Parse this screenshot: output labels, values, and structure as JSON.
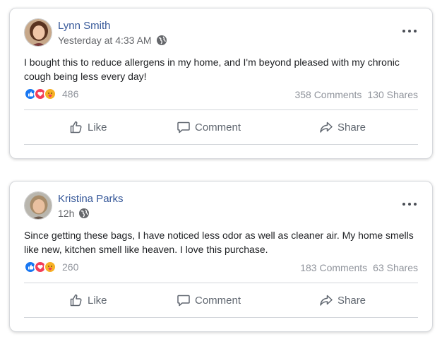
{
  "posts": [
    {
      "author": "Lynn Smith",
      "time": "Yesterday at 4:33 AM",
      "text": "I bought this to reduce allergens in my home, and I'm beyond pleased with my chronic cough being less every day!",
      "reaction_count": "486",
      "comments": "358 Comments",
      "shares": "130 Shares"
    },
    {
      "author": "Kristina Parks",
      "time": "12h",
      "text": "Since getting these bags, I have noticed less odor as well as cleaner air. My home smells like new, kitchen smell like heaven. I love this purchase.",
      "reaction_count": "260",
      "comments": "183 Comments",
      "shares": "63 Shares"
    }
  ],
  "actions": {
    "like": "Like",
    "comment": "Comment",
    "share": "Share"
  },
  "icons": {
    "globe": "globe-icon",
    "more": "more-options-icon",
    "like": "thumbs-up-icon",
    "comment": "comment-bubble-icon",
    "share": "share-arrow-icon",
    "reactions": [
      "like-reaction-icon",
      "love-reaction-icon",
      "care-reaction-icon"
    ]
  },
  "colors": {
    "author": "#365899",
    "meta": "#65676b",
    "action": "#606770",
    "like_reaction": "#1877f2",
    "love_reaction": "#f33e58",
    "care_reaction": "#f7b125"
  }
}
